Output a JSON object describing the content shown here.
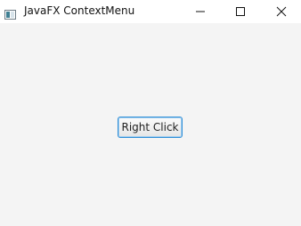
{
  "window": {
    "title": "JavaFX ContextMenu",
    "app_icon": "java-app-icon",
    "controls": {
      "minimize_icon": "minimize-icon",
      "maximize_icon": "maximize-icon",
      "close_icon": "close-icon"
    }
  },
  "main": {
    "button_label": "Right Click"
  },
  "colors": {
    "background": "#f4f4f4",
    "titlebar": "#ffffff",
    "button_border": "#2f8fd8"
  }
}
